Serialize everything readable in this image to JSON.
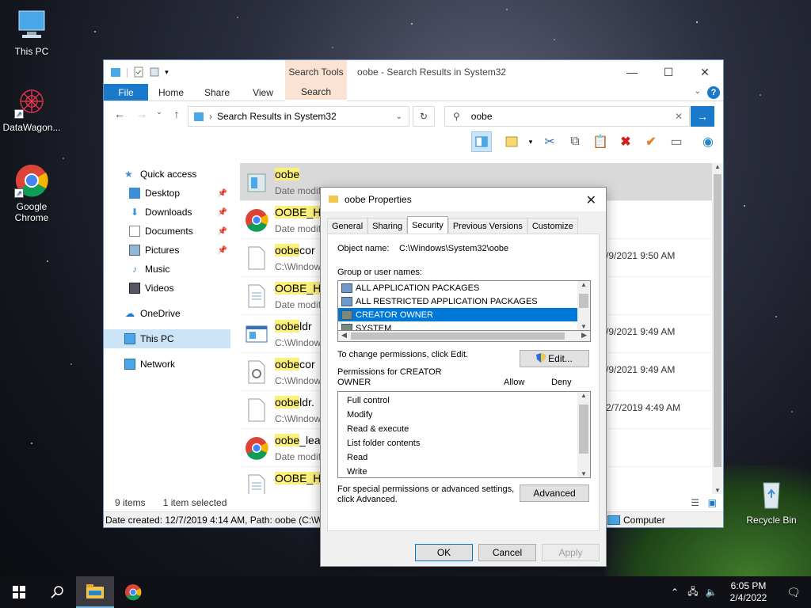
{
  "desktop": {
    "icons": [
      {
        "label": "This PC"
      },
      {
        "label": "DataWagon..."
      },
      {
        "label": "Google Chrome"
      },
      {
        "label": "Recycle Bin"
      }
    ]
  },
  "explorer": {
    "title": "oobe - Search Results in System32",
    "context_tab_header": "Search Tools",
    "tabs": [
      "File",
      "Home",
      "Share",
      "View",
      "Search"
    ],
    "address": "Search Results in System32",
    "search_value": "oobe",
    "nav": {
      "quick_access": "Quick access",
      "items": [
        "Desktop",
        "Downloads",
        "Documents",
        "Pictures",
        "Music",
        "Videos"
      ],
      "onedrive": "OneDrive",
      "this_pc": "This PC",
      "network": "Network"
    },
    "files": [
      {
        "hl": "oobe",
        "rest": "",
        "sub": "Date modif",
        "date": "",
        "icon": "folder"
      },
      {
        "hl": "OOBE_H",
        "rest": "",
        "sub": "Date modif",
        "date": "",
        "icon": "chrome"
      },
      {
        "hl": "oobe",
        "rest": "cor",
        "sub": "C:\\Window",
        "date": "/9/2021 9:50 AM",
        "icon": "file"
      },
      {
        "hl": "OOBE_H",
        "rest": "",
        "sub": "Date modif",
        "date": "",
        "icon": "doc"
      },
      {
        "hl": "oobe",
        "rest": "ldr",
        "sub": "C:\\Window",
        "date": "/9/2021 9:49 AM",
        "icon": "app"
      },
      {
        "hl": "oobe",
        "rest": "cor",
        "sub": "C:\\Window",
        "date": "/9/2021 9:49 AM",
        "icon": "gear"
      },
      {
        "hl": "oobe",
        "rest": "ldr.",
        "sub": "C:\\Window",
        "date": "2/7/2019 4:49 AM",
        "icon": "file"
      },
      {
        "hl": "oobe",
        "rest": "_lea",
        "sub": "Date modif",
        "date": "",
        "icon": "chrome"
      },
      {
        "hl": "OOBE_H",
        "rest": "",
        "sub": "",
        "date": "",
        "icon": "doc"
      }
    ],
    "status": {
      "count": "9 items",
      "selected": "1 item selected"
    },
    "infobar": {
      "text": "Date created: 12/7/2019 4:14 AM, Path: oobe (C:\\Wi",
      "computer": "Computer"
    }
  },
  "props": {
    "title": "oobe Properties",
    "tabs": [
      "General",
      "Sharing",
      "Security",
      "Previous Versions",
      "Customize"
    ],
    "object_name_label": "Object name:",
    "object_name_value": "C:\\Windows\\System32\\oobe",
    "group_label": "Group or user names:",
    "groups": [
      "ALL APPLICATION PACKAGES",
      "ALL RESTRICTED APPLICATION PACKAGES",
      "CREATOR OWNER",
      "SYSTEM"
    ],
    "change_text": "To change permissions, click Edit.",
    "edit_label": "Edit...",
    "perm_for_1": "Permissions for CREATOR",
    "perm_for_2": "OWNER",
    "allow": "Allow",
    "deny": "Deny",
    "perms": [
      "Full control",
      "Modify",
      "Read & execute",
      "List folder contents",
      "Read",
      "Write"
    ],
    "special_1": "For special permissions or advanced settings,",
    "special_2": "click Advanced.",
    "advanced_label": "Advanced",
    "ok": "OK",
    "cancel": "Cancel",
    "apply": "Apply"
  },
  "taskbar": {
    "time": "6:05 PM",
    "date": "2/4/2022"
  }
}
